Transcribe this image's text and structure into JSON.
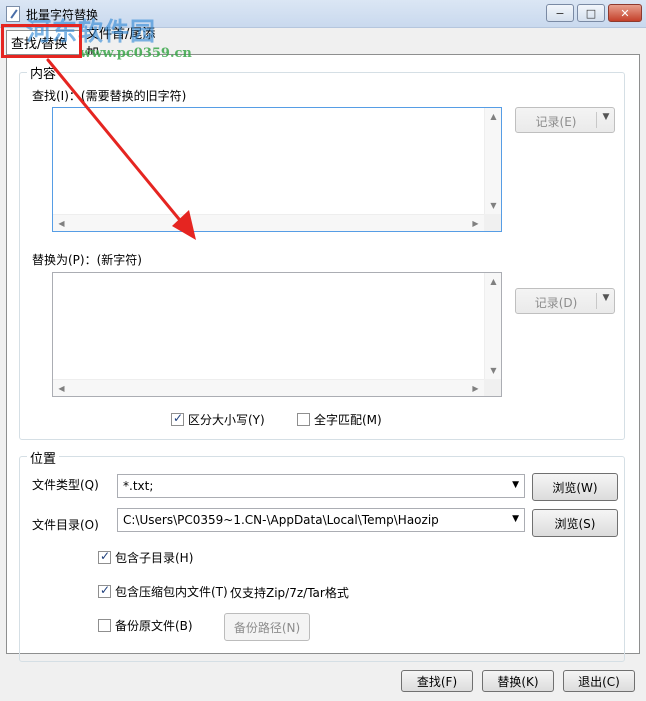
{
  "window": {
    "title": "批量字符替换",
    "minimize": "−",
    "maximize": "□",
    "close": "✕"
  },
  "tabs": [
    {
      "label": "查找/替换",
      "active": true
    },
    {
      "label": "文件首/尾添加",
      "active": false
    }
  ],
  "content_group": {
    "title": "内容",
    "find_label": "查找(I)：(需要替换的旧字符)",
    "find_value": "",
    "find_record_button": "记录(E)",
    "replace_label": "替换为(P)：(新字符)",
    "replace_value": "",
    "replace_record_button": "记录(D)",
    "case_sensitive": {
      "label": "区分大小写(Y)",
      "checked": true
    },
    "whole_word": {
      "label": "全字匹配(M)",
      "checked": false
    }
  },
  "location_group": {
    "title": "位置",
    "file_type_label": "文件类型(Q)",
    "file_type_value": "*.txt;",
    "browse_w": "浏览(W)",
    "file_dir_label": "文件目录(O)",
    "file_dir_value": "C:\\Users\\PC0359~1.CN-\\AppData\\Local\\Temp\\Haozip",
    "browse_s": "浏览(S)",
    "include_subdirs": {
      "label": "包含子目录(H)",
      "checked": true
    },
    "include_archives": {
      "label": "包含压缩包内文件(T)",
      "checked": true
    },
    "archive_note": "仅支持Zip/7z/Tar格式",
    "backup": {
      "label": "备份原文件(B)",
      "checked": false
    },
    "backup_path_button": "备份路径(N)"
  },
  "footer": {
    "find_button": "查找(F)",
    "replace_button": "替换(K)",
    "exit_button": "退出(C)"
  },
  "watermark": {
    "line1": "河东软件园",
    "line2": "www.pc0359.cn"
  },
  "colors": {
    "annotation": "#e52521",
    "titlebar": "#dbe6f4",
    "focus_border": "#569de5"
  }
}
